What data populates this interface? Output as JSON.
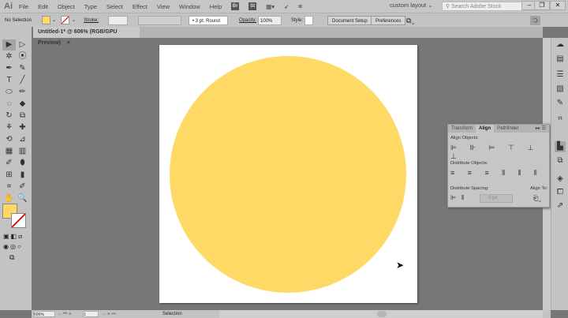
{
  "app": {
    "logo": "Ai",
    "menu": [
      "File",
      "Edit",
      "Object",
      "Type",
      "Select",
      "Effect",
      "View",
      "Window",
      "Help"
    ],
    "bridge": "Br",
    "stock": "St",
    "workspace": "custom layout",
    "search_placeholder": "Search Adobe Stock"
  },
  "control": {
    "selection": "No Selection",
    "stroke_label": "Stroke:",
    "brush": "3 pt. Round",
    "opacity_label": "Opacity:",
    "opacity": "100%",
    "style_label": "Style:",
    "document_setup": "Document Setup",
    "preferences": "Preferences"
  },
  "document": {
    "tab_title": "Untitled-1* @ 606% (RGB/GPU Preview)",
    "close": "×"
  },
  "colors": {
    "fill": "#ffd966",
    "accent": "#ffd966"
  },
  "tools": [
    "▶",
    "▷",
    "✲",
    "⦿",
    "✒",
    "✎",
    "T",
    "╱",
    "⬭",
    "✏",
    "◌",
    "◆",
    "↻",
    "⧉",
    "⚘",
    "✚",
    "⟲",
    "⊿",
    "▦",
    "▥",
    "✐",
    "⬮",
    "⊞",
    "▮",
    "⌗",
    "✐",
    "✋",
    "🔍"
  ],
  "align_panel": {
    "tabs": [
      "Transform",
      "Align",
      "Pathfinder"
    ],
    "align_objects": "Align Objects:",
    "distribute_objects": "Distribute Objects:",
    "distribute_spacing": "Distribute Spacing:",
    "align_to": "Align To:",
    "spacing_value": "0 px",
    "align_icons": "⊫ ⊪ ⊨ ⊤ ⊥ ⊥",
    "dist_icons": "≡ ≡ ≡ ⫴ ⫴ ⫴"
  },
  "status": {
    "zoom": "606%",
    "page": "1",
    "mode": "Selection"
  }
}
